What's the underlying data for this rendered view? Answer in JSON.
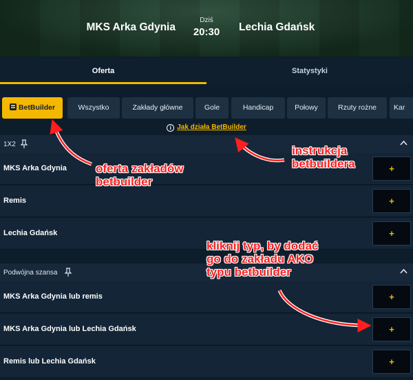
{
  "match": {
    "home": "MKS Arka Gdynia",
    "away": "Lechia Gdańsk",
    "day": "Dziś",
    "time": "20:30"
  },
  "tabs": [
    {
      "label": "Oferta",
      "active": true
    },
    {
      "label": "Statystyki",
      "active": false
    }
  ],
  "filters": [
    {
      "label": "BetBuilder",
      "active": true
    },
    {
      "label": "Wszystko"
    },
    {
      "label": "Zakłady główne"
    },
    {
      "label": "Gole"
    },
    {
      "label": "Handicap"
    },
    {
      "label": "Połowy"
    },
    {
      "label": "Rzuty rożne"
    },
    {
      "label": "Kar"
    }
  ],
  "how_link": "Jak działa BetBuilder",
  "sections": [
    {
      "title": "1X2",
      "rows": [
        {
          "name": "MKS Arka Gdynia",
          "button": "+"
        },
        {
          "name": "Remis",
          "button": "+"
        },
        {
          "name": "Lechia Gdańsk",
          "button": "+"
        }
      ]
    },
    {
      "title": "Podwójna szansa",
      "rows": [
        {
          "name": "MKS Arka Gdynia lub remis",
          "button": "+"
        },
        {
          "name": "MKS Arka Gdynia lub Lechia Gdańsk",
          "button": "+"
        },
        {
          "name": "Remis lub Lechia Gdańsk",
          "button": "+"
        }
      ]
    }
  ],
  "annotations": {
    "offer": [
      "oferta zakładów",
      "betbuilder"
    ],
    "instruction": [
      "instrukcja",
      "betbuildera"
    ],
    "click": [
      "kliknij typ, by dodać",
      "go do zakładu AKO",
      "typu betbuilder"
    ]
  },
  "colors": {
    "accent": "#f5b800",
    "background": "#0e1d2b",
    "annotation": "#ff1f1f"
  }
}
